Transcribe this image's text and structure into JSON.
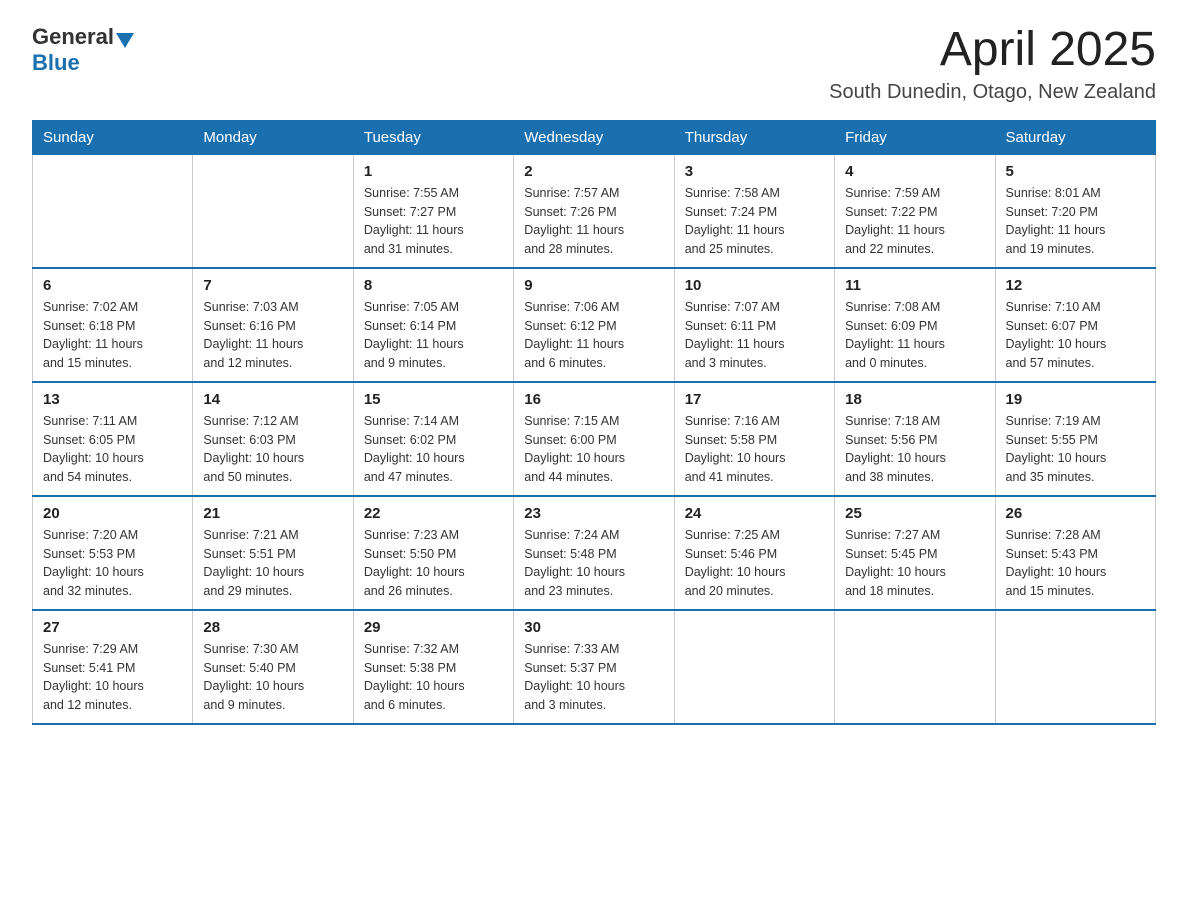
{
  "header": {
    "logo_general": "General",
    "logo_blue": "Blue",
    "month_title": "April 2025",
    "location": "South Dunedin, Otago, New Zealand"
  },
  "days_of_week": [
    "Sunday",
    "Monday",
    "Tuesday",
    "Wednesday",
    "Thursday",
    "Friday",
    "Saturday"
  ],
  "weeks": [
    [
      {
        "day": "",
        "info": ""
      },
      {
        "day": "",
        "info": ""
      },
      {
        "day": "1",
        "info": "Sunrise: 7:55 AM\nSunset: 7:27 PM\nDaylight: 11 hours\nand 31 minutes."
      },
      {
        "day": "2",
        "info": "Sunrise: 7:57 AM\nSunset: 7:26 PM\nDaylight: 11 hours\nand 28 minutes."
      },
      {
        "day": "3",
        "info": "Sunrise: 7:58 AM\nSunset: 7:24 PM\nDaylight: 11 hours\nand 25 minutes."
      },
      {
        "day": "4",
        "info": "Sunrise: 7:59 AM\nSunset: 7:22 PM\nDaylight: 11 hours\nand 22 minutes."
      },
      {
        "day": "5",
        "info": "Sunrise: 8:01 AM\nSunset: 7:20 PM\nDaylight: 11 hours\nand 19 minutes."
      }
    ],
    [
      {
        "day": "6",
        "info": "Sunrise: 7:02 AM\nSunset: 6:18 PM\nDaylight: 11 hours\nand 15 minutes."
      },
      {
        "day": "7",
        "info": "Sunrise: 7:03 AM\nSunset: 6:16 PM\nDaylight: 11 hours\nand 12 minutes."
      },
      {
        "day": "8",
        "info": "Sunrise: 7:05 AM\nSunset: 6:14 PM\nDaylight: 11 hours\nand 9 minutes."
      },
      {
        "day": "9",
        "info": "Sunrise: 7:06 AM\nSunset: 6:12 PM\nDaylight: 11 hours\nand 6 minutes."
      },
      {
        "day": "10",
        "info": "Sunrise: 7:07 AM\nSunset: 6:11 PM\nDaylight: 11 hours\nand 3 minutes."
      },
      {
        "day": "11",
        "info": "Sunrise: 7:08 AM\nSunset: 6:09 PM\nDaylight: 11 hours\nand 0 minutes."
      },
      {
        "day": "12",
        "info": "Sunrise: 7:10 AM\nSunset: 6:07 PM\nDaylight: 10 hours\nand 57 minutes."
      }
    ],
    [
      {
        "day": "13",
        "info": "Sunrise: 7:11 AM\nSunset: 6:05 PM\nDaylight: 10 hours\nand 54 minutes."
      },
      {
        "day": "14",
        "info": "Sunrise: 7:12 AM\nSunset: 6:03 PM\nDaylight: 10 hours\nand 50 minutes."
      },
      {
        "day": "15",
        "info": "Sunrise: 7:14 AM\nSunset: 6:02 PM\nDaylight: 10 hours\nand 47 minutes."
      },
      {
        "day": "16",
        "info": "Sunrise: 7:15 AM\nSunset: 6:00 PM\nDaylight: 10 hours\nand 44 minutes."
      },
      {
        "day": "17",
        "info": "Sunrise: 7:16 AM\nSunset: 5:58 PM\nDaylight: 10 hours\nand 41 minutes."
      },
      {
        "day": "18",
        "info": "Sunrise: 7:18 AM\nSunset: 5:56 PM\nDaylight: 10 hours\nand 38 minutes."
      },
      {
        "day": "19",
        "info": "Sunrise: 7:19 AM\nSunset: 5:55 PM\nDaylight: 10 hours\nand 35 minutes."
      }
    ],
    [
      {
        "day": "20",
        "info": "Sunrise: 7:20 AM\nSunset: 5:53 PM\nDaylight: 10 hours\nand 32 minutes."
      },
      {
        "day": "21",
        "info": "Sunrise: 7:21 AM\nSunset: 5:51 PM\nDaylight: 10 hours\nand 29 minutes."
      },
      {
        "day": "22",
        "info": "Sunrise: 7:23 AM\nSunset: 5:50 PM\nDaylight: 10 hours\nand 26 minutes."
      },
      {
        "day": "23",
        "info": "Sunrise: 7:24 AM\nSunset: 5:48 PM\nDaylight: 10 hours\nand 23 minutes."
      },
      {
        "day": "24",
        "info": "Sunrise: 7:25 AM\nSunset: 5:46 PM\nDaylight: 10 hours\nand 20 minutes."
      },
      {
        "day": "25",
        "info": "Sunrise: 7:27 AM\nSunset: 5:45 PM\nDaylight: 10 hours\nand 18 minutes."
      },
      {
        "day": "26",
        "info": "Sunrise: 7:28 AM\nSunset: 5:43 PM\nDaylight: 10 hours\nand 15 minutes."
      }
    ],
    [
      {
        "day": "27",
        "info": "Sunrise: 7:29 AM\nSunset: 5:41 PM\nDaylight: 10 hours\nand 12 minutes."
      },
      {
        "day": "28",
        "info": "Sunrise: 7:30 AM\nSunset: 5:40 PM\nDaylight: 10 hours\nand 9 minutes."
      },
      {
        "day": "29",
        "info": "Sunrise: 7:32 AM\nSunset: 5:38 PM\nDaylight: 10 hours\nand 6 minutes."
      },
      {
        "day": "30",
        "info": "Sunrise: 7:33 AM\nSunset: 5:37 PM\nDaylight: 10 hours\nand 3 minutes."
      },
      {
        "day": "",
        "info": ""
      },
      {
        "day": "",
        "info": ""
      },
      {
        "day": "",
        "info": ""
      }
    ]
  ]
}
